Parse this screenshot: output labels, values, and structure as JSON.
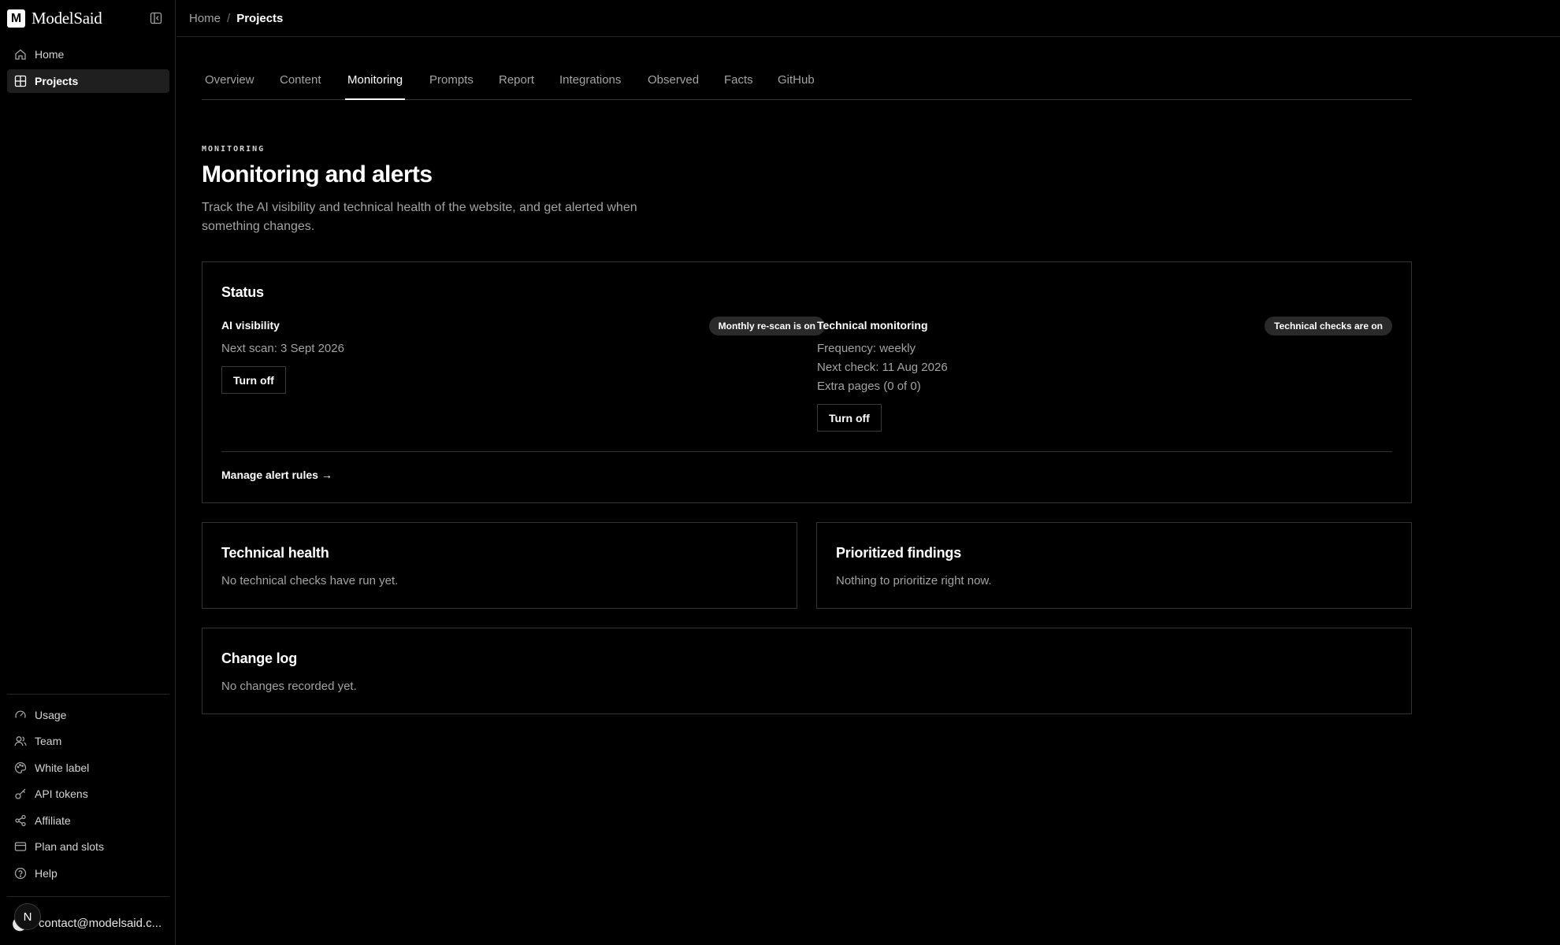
{
  "brand": {
    "logo_letter": "M",
    "name": "ModelSaid"
  },
  "sidebar": {
    "primary": [
      {
        "label": "Home",
        "icon": "home-icon",
        "active": false
      },
      {
        "label": "Projects",
        "icon": "grid-icon",
        "active": true
      }
    ],
    "secondary": [
      {
        "label": "Usage",
        "icon": "gauge-icon"
      },
      {
        "label": "Team",
        "icon": "users-icon"
      },
      {
        "label": "White label",
        "icon": "palette-icon"
      },
      {
        "label": "API tokens",
        "icon": "key-icon"
      },
      {
        "label": "Affiliate",
        "icon": "share-icon"
      },
      {
        "label": "Plan and slots",
        "icon": "card-icon"
      },
      {
        "label": "Help",
        "icon": "help-icon"
      }
    ],
    "user": {
      "avatar_letter": "N",
      "email": "contact@modelsaid.c..."
    }
  },
  "breadcrumb": {
    "home": "Home",
    "separator": "/",
    "current": "Projects"
  },
  "tabs": [
    "Overview",
    "Content",
    "Monitoring",
    "Prompts",
    "Report",
    "Integrations",
    "Observed",
    "Facts",
    "GitHub"
  ],
  "active_tab": "Monitoring",
  "header": {
    "eyebrow": "MONITORING",
    "title": "Monitoring and alerts",
    "description": "Track the AI visibility and technical health of the website, and get alerted when something changes."
  },
  "status": {
    "title": "Status",
    "ai_visibility": {
      "title": "AI visibility",
      "badge": "Monthly re-scan is on",
      "next_scan": "Next scan: 3 Sept 2026",
      "button": "Turn off"
    },
    "technical_monitoring": {
      "title": "Technical monitoring",
      "badge": "Technical checks are on",
      "frequency": "Frequency: weekly",
      "next_check": "Next check: 11 Aug 2026",
      "extra_pages": "Extra pages (0 of 0)",
      "button": "Turn off"
    },
    "manage_link": "Manage alert rules →"
  },
  "technical_health": {
    "title": "Technical health",
    "message": "No technical checks have run yet."
  },
  "prioritized_findings": {
    "title": "Prioritized findings",
    "message": "Nothing to prioritize right now."
  },
  "change_log": {
    "title": "Change log",
    "message": "No changes recorded yet."
  },
  "colors": {
    "background": "#000000",
    "border": "#333333",
    "muted_text": "#a3a3a3",
    "active_nav_bg": "#1f1f1f",
    "badge_bg": "#2a2a2a"
  }
}
